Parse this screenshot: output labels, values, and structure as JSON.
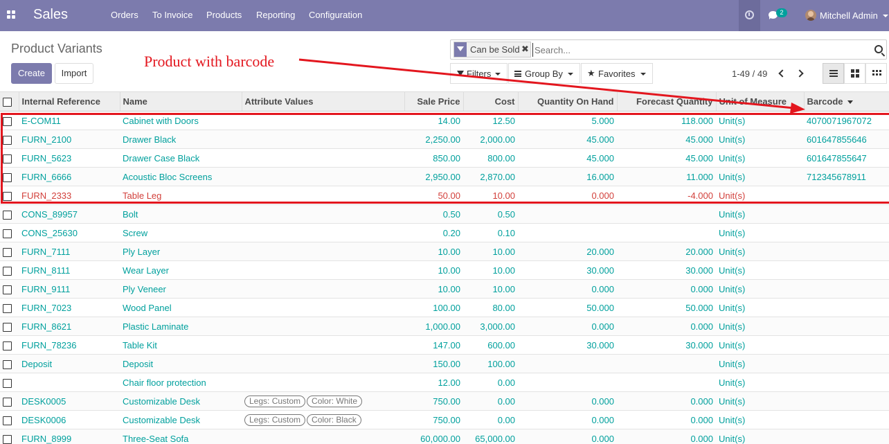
{
  "navbar": {
    "brand": "Sales",
    "menu": [
      "Orders",
      "To Invoice",
      "Products",
      "Reporting",
      "Configuration"
    ],
    "chat_count": "2",
    "user_name": "Mitchell Admin"
  },
  "control_panel": {
    "breadcrumb": "Product Variants",
    "create_label": "Create",
    "import_label": "Import",
    "facet_label": "Can be Sold",
    "facet_close": "✖",
    "search_placeholder": "Search...",
    "filters_label": "Filters",
    "groupby_label": "Group By",
    "favorites_label": "Favorites",
    "pager": "1-49 / 49"
  },
  "annotation": "Product with barcode",
  "columns": [
    "Internal Reference",
    "Name",
    "Attribute Values",
    "Sale Price",
    "Cost",
    "Quantity On Hand",
    "Forecast Quantity",
    "Unit of Measure",
    "Barcode"
  ],
  "rows": [
    {
      "ref": "E-COM11",
      "name": "Cabinet with Doors",
      "attrs": [],
      "price": "14.00",
      "cost": "12.50",
      "qoh": "5.000",
      "forecast": "118.000",
      "uom": "Unit(s)",
      "barcode": "4070071967072"
    },
    {
      "ref": "FURN_2100",
      "name": "Drawer Black",
      "attrs": [],
      "price": "2,250.00",
      "cost": "2,000.00",
      "qoh": "45.000",
      "forecast": "45.000",
      "uom": "Unit(s)",
      "barcode": "601647855646"
    },
    {
      "ref": "FURN_5623",
      "name": "Drawer Case Black",
      "attrs": [],
      "price": "850.00",
      "cost": "800.00",
      "qoh": "45.000",
      "forecast": "45.000",
      "uom": "Unit(s)",
      "barcode": "601647855647"
    },
    {
      "ref": "FURN_6666",
      "name": "Acoustic Bloc Screens",
      "attrs": [],
      "price": "2,950.00",
      "cost": "2,870.00",
      "qoh": "16.000",
      "forecast": "11.000",
      "uom": "Unit(s)",
      "barcode": "712345678911"
    },
    {
      "ref": "FURN_2333",
      "name": "Table Leg",
      "attrs": [],
      "price": "50.00",
      "cost": "10.00",
      "qoh": "0.000",
      "forecast": "-4.000",
      "uom": "Unit(s)",
      "barcode": "",
      "negative": true
    },
    {
      "ref": "CONS_89957",
      "name": "Bolt",
      "attrs": [],
      "price": "0.50",
      "cost": "0.50",
      "qoh": "",
      "forecast": "",
      "uom": "Unit(s)",
      "barcode": ""
    },
    {
      "ref": "CONS_25630",
      "name": "Screw",
      "attrs": [],
      "price": "0.20",
      "cost": "0.10",
      "qoh": "",
      "forecast": "",
      "uom": "Unit(s)",
      "barcode": ""
    },
    {
      "ref": "FURN_7111",
      "name": "Ply Layer",
      "attrs": [],
      "price": "10.00",
      "cost": "10.00",
      "qoh": "20.000",
      "forecast": "20.000",
      "uom": "Unit(s)",
      "barcode": ""
    },
    {
      "ref": "FURN_8111",
      "name": "Wear Layer",
      "attrs": [],
      "price": "10.00",
      "cost": "10.00",
      "qoh": "30.000",
      "forecast": "30.000",
      "uom": "Unit(s)",
      "barcode": ""
    },
    {
      "ref": "FURN_9111",
      "name": "Ply Veneer",
      "attrs": [],
      "price": "10.00",
      "cost": "10.00",
      "qoh": "0.000",
      "forecast": "0.000",
      "uom": "Unit(s)",
      "barcode": ""
    },
    {
      "ref": "FURN_7023",
      "name": "Wood Panel",
      "attrs": [],
      "price": "100.00",
      "cost": "80.00",
      "qoh": "50.000",
      "forecast": "50.000",
      "uom": "Unit(s)",
      "barcode": ""
    },
    {
      "ref": "FURN_8621",
      "name": "Plastic Laminate",
      "attrs": [],
      "price": "1,000.00",
      "cost": "3,000.00",
      "qoh": "0.000",
      "forecast": "0.000",
      "uom": "Unit(s)",
      "barcode": ""
    },
    {
      "ref": "FURN_78236",
      "name": "Table Kit",
      "attrs": [],
      "price": "147.00",
      "cost": "600.00",
      "qoh": "30.000",
      "forecast": "30.000",
      "uom": "Unit(s)",
      "barcode": ""
    },
    {
      "ref": "Deposit",
      "name": "Deposit",
      "attrs": [],
      "price": "150.00",
      "cost": "100.00",
      "qoh": "",
      "forecast": "",
      "uom": "Unit(s)",
      "barcode": ""
    },
    {
      "ref": "",
      "name": "Chair floor protection",
      "attrs": [],
      "price": "12.00",
      "cost": "0.00",
      "qoh": "",
      "forecast": "",
      "uom": "Unit(s)",
      "barcode": ""
    },
    {
      "ref": "DESK0005",
      "name": "Customizable Desk",
      "attrs": [
        "Legs: Custom",
        "Color: White"
      ],
      "price": "750.00",
      "cost": "0.00",
      "qoh": "0.000",
      "forecast": "0.000",
      "uom": "Unit(s)",
      "barcode": ""
    },
    {
      "ref": "DESK0006",
      "name": "Customizable Desk",
      "attrs": [
        "Legs: Custom",
        "Color: Black"
      ],
      "price": "750.00",
      "cost": "0.00",
      "qoh": "0.000",
      "forecast": "0.000",
      "uom": "Unit(s)",
      "barcode": ""
    },
    {
      "ref": "FURN_8999",
      "name": "Three-Seat Sofa",
      "attrs": [],
      "price": "60,000.00",
      "cost": "65,000.00",
      "qoh": "0.000",
      "forecast": "0.000",
      "uom": "Unit(s)",
      "barcode": ""
    }
  ],
  "colors": {
    "navbar": "#7c7bad",
    "link": "#00a09d",
    "negative": "#d23f3a",
    "annotation": "#e3161e"
  }
}
